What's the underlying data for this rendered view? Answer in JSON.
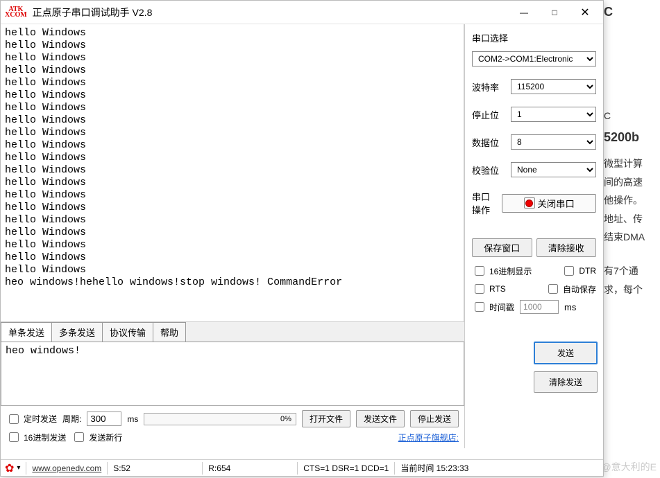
{
  "window": {
    "title": "正点原子串口调试助手 V2.8",
    "logo_line1": "ATK",
    "logo_line2": "XCOM",
    "min": "—",
    "max": "□",
    "close": "✕"
  },
  "rx_text": "hello Windows\nhello Windows\nhello Windows\nhello Windows\nhello Windows\nhello Windows\nhello Windows\nhello Windows\nhello Windows\nhello Windows\nhello Windows\nhello Windows\nhello Windows\nhello Windows\nhello Windows\nhello Windows\nhello Windows\nhello Windows\nhello Windows\nhello Windows\nheo windows!hehello windows!stop windows! CommandError",
  "tabs": {
    "single": "单条发送",
    "multi": "多条发送",
    "proto": "协议传输",
    "help": "帮助"
  },
  "tx_text": "heo windows!",
  "bottom": {
    "timed_send": "定时发送",
    "period_label": "周期:",
    "period_value": "300",
    "period_unit": "ms",
    "progress_pct": "0%",
    "open_file": "打开文件",
    "send_file": "发送文件",
    "stop_send": "停止发送",
    "hex_send": "16进制发送",
    "send_newline": "发送新行",
    "shop_link": "正点原子旗舰店:"
  },
  "right": {
    "port_section": "串口选择",
    "port_value": "COM2->COM1:Electronic",
    "baud_label": "波特率",
    "baud_value": "115200",
    "stop_label": "停止位",
    "stop_value": "1",
    "data_label": "数据位",
    "data_value": "8",
    "parity_label": "校验位",
    "parity_value": "None",
    "op_label": "串口操作",
    "op_button": "关闭串口",
    "save_win": "保存窗口",
    "clear_rx": "清除接收",
    "hex_display": "16进制显示",
    "dtr": "DTR",
    "rts": "RTS",
    "auto_save": "自动保存",
    "timestamp": "时间戳",
    "timestamp_value": "1000",
    "timestamp_unit": "ms"
  },
  "send": {
    "send": "发送",
    "clear": "清除发送"
  },
  "status": {
    "url": "www.openedv.com",
    "s": "S:52",
    "r": "R:654",
    "signals": "CTS=1 DSR=1 DCD=1",
    "time_label": "当前时间 15:23:33"
  },
  "bg": {
    "l1": "5200b",
    "l2": "微型计算",
    "l3": "间的高速",
    "l4": "他操作。",
    "l5": "地址、传",
    "l6": "结束DMA",
    "l7": "有7个通",
    "l8": "求，每个"
  },
  "watermark": "CSDN @意大利的E"
}
